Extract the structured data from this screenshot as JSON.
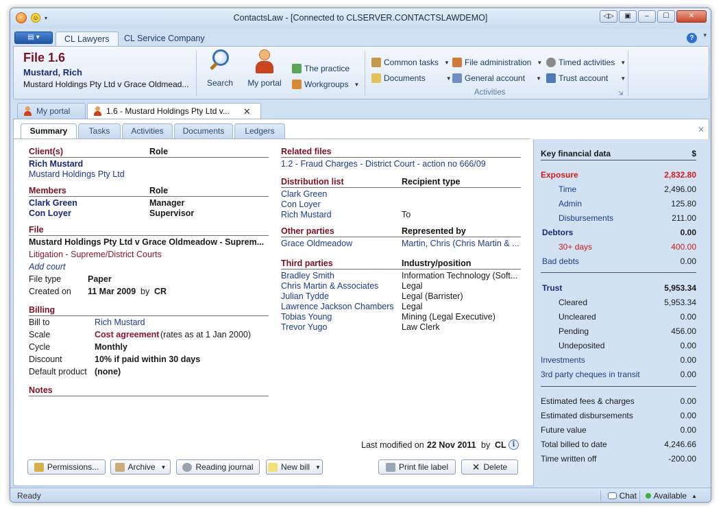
{
  "window": {
    "title": "ContactsLaw - [Connected to CLSERVER.CONTACTSLAWDEMO]",
    "buttons": {
      "restore_down": "◁▷",
      "switch": "▣",
      "minimize": "–",
      "maximize": "☐",
      "close": "✕"
    }
  },
  "ribbon_tabs": {
    "app_menu_glyph": "▤ ▾",
    "tabs": [
      {
        "label": "CL Lawyers",
        "active": true
      },
      {
        "label": "CL Service Company",
        "active": false
      }
    ],
    "help": "?"
  },
  "file_header": {
    "file_no": "File 1.6",
    "client": "Mustard, Rich",
    "matter": "Mustard Holdings Pty Ltd v Grace Oldmead..."
  },
  "ribbon": {
    "search_label": "Search",
    "my_portal_label": "My portal",
    "the_practice_label": "The practice",
    "workgroups_label": "Workgroups",
    "common_tasks_label": "Common tasks",
    "documents_label": "Documents",
    "file_administration_label": "File administration",
    "general_account_label": "General account",
    "timed_activities_label": "Timed activities",
    "trust_account_label": "Trust account",
    "activities_group_label": "Activities"
  },
  "doc_tabs": [
    {
      "label": "My portal",
      "active": false
    },
    {
      "label": "1.6 - Mustard Holdings Pty Ltd v...",
      "active": true
    }
  ],
  "subtabs": [
    {
      "label": "Summary",
      "active": true
    },
    {
      "label": "Tasks",
      "active": false
    },
    {
      "label": "Activities",
      "active": false
    },
    {
      "label": "Documents",
      "active": false
    },
    {
      "label": "Ledgers",
      "active": false
    }
  ],
  "clients": {
    "heading": "Client(s)",
    "role_heading": "Role",
    "primary": "Rich Mustard",
    "secondary": "Mustard Holdings Pty Ltd"
  },
  "members": {
    "heading": "Members",
    "role_heading": "Role",
    "rows": [
      {
        "name": "Clark Green",
        "role": "Manager"
      },
      {
        "name": "Con Loyer",
        "role": "Supervisor"
      }
    ]
  },
  "file": {
    "heading": "File",
    "matter_full": "Mustard Holdings Pty Ltd v Grace Oldmeadow - Suprem...",
    "category": "Litigation - Supreme/District Courts",
    "add_court": "Add court",
    "file_type_label": "File type",
    "file_type": "Paper",
    "created_on_label": "Created on",
    "created_on": "11 Mar 2009",
    "by": "by",
    "created_by": "CR"
  },
  "billing": {
    "heading": "Billing",
    "bill_to_label": "Bill to",
    "bill_to": "Rich Mustard",
    "scale_label": "Scale",
    "scale": "Cost agreement",
    "scale_note": "(rates as at 1 Jan 2000)",
    "cycle_label": "Cycle",
    "cycle": "Monthly",
    "discount_label": "Discount",
    "discount": "10% if paid within 30 days",
    "default_product_label": "Default product",
    "default_product": "(none)"
  },
  "notes": {
    "heading": "Notes"
  },
  "related_files": {
    "heading": "Related files",
    "item": "1.2 - Fraud Charges - District Court - action no 666/09"
  },
  "distribution": {
    "heading": "Distribution list",
    "type_heading": "Recipient type",
    "rows": [
      {
        "name": "Clark Green",
        "type": ""
      },
      {
        "name": "Con Loyer",
        "type": ""
      },
      {
        "name": "Rich Mustard",
        "type": "To"
      }
    ]
  },
  "other_parties": {
    "heading": "Other parties",
    "rep_heading": "Represented by",
    "rows": [
      {
        "name": "Grace Oldmeadow",
        "rep": "Martin, Chris (Chris Martin & ..."
      }
    ]
  },
  "third_parties": {
    "heading": "Third parties",
    "ind_heading": "Industry/position",
    "rows": [
      {
        "name": "Bradley Smith",
        "industry": "Information Technology (Soft..."
      },
      {
        "name": "Chris Martin & Associates",
        "industry": "Legal"
      },
      {
        "name": "Julian Tydde",
        "industry": "Legal (Barrister)"
      },
      {
        "name": "Lawrence Jackson Chambers",
        "industry": "Legal"
      },
      {
        "name": "Tobias Young",
        "industry": "Mining (Legal Executive)"
      },
      {
        "name": "Trevor Yugo",
        "industry": "Law Clerk"
      }
    ]
  },
  "last_modified": {
    "label": "Last modified on",
    "date": "22 Nov 2011",
    "by": "by",
    "user": "CL",
    "info": "i"
  },
  "financial": {
    "heading": "Key financial data",
    "currency": "$",
    "exposure_label": "Exposure",
    "exposure": "2,832.80",
    "time_label": "Time",
    "time": "2,496.00",
    "admin_label": "Admin",
    "admin": "125.80",
    "disb_label": "Disbursements",
    "disb": "211.00",
    "debtors_label": "Debtors",
    "debtors": "0.00",
    "days30_label": "30+ days",
    "days30": "400.00",
    "bad_debts_label": "Bad debts",
    "bad_debts": "0.00",
    "trust_label": "Trust",
    "trust": "5,953.34",
    "cleared_label": "Cleared",
    "cleared": "5,953.34",
    "uncleared_label": "Uncleared",
    "uncleared": "0.00",
    "pending_label": "Pending",
    "pending": "456.00",
    "undeposited_label": "Undeposited",
    "undeposited": "0.00",
    "investments_label": "Investments",
    "investments": "0.00",
    "cheques_label": "3rd party cheques in transit",
    "cheques": "0.00",
    "est_fees_label": "Estimated fees & charges",
    "est_fees": "0.00",
    "est_disb_label": "Estimated disbursements",
    "est_disb": "0.00",
    "future_value_label": "Future value",
    "future_value": "0.00",
    "total_billed_label": "Total billed to date",
    "total_billed": "4,246.66",
    "written_off_label": "Time written off",
    "written_off": "-200.00"
  },
  "actions": {
    "permissions": "Permissions...",
    "archive": "Archive",
    "reading_journal": "Reading journal",
    "new_bill": "New bill",
    "print_label": "Print file label",
    "delete": "Delete"
  },
  "status": {
    "ready": "Ready",
    "chat": "Chat",
    "available": "Available",
    "available_caret": "▲"
  },
  "colors": {
    "brand_red": "#7d1023",
    "link_blue": "#1a3c8c",
    "exposure_red": "#d11a1a",
    "panel_blue": "#d3e2f2",
    "available_green": "#3cb23c"
  },
  "icons": [
    "search-icon",
    "person-icon",
    "globe-icon",
    "workgroups-icon",
    "home-icon",
    "documents-icon",
    "file-admin-icon",
    "general-account-icon",
    "timer-icon",
    "trust-account-icon",
    "lock-icon",
    "archive-icon",
    "clock-icon",
    "new-bill-icon",
    "printer-icon",
    "delete-icon",
    "info-icon",
    "chat-icon",
    "available-dot-icon"
  ]
}
